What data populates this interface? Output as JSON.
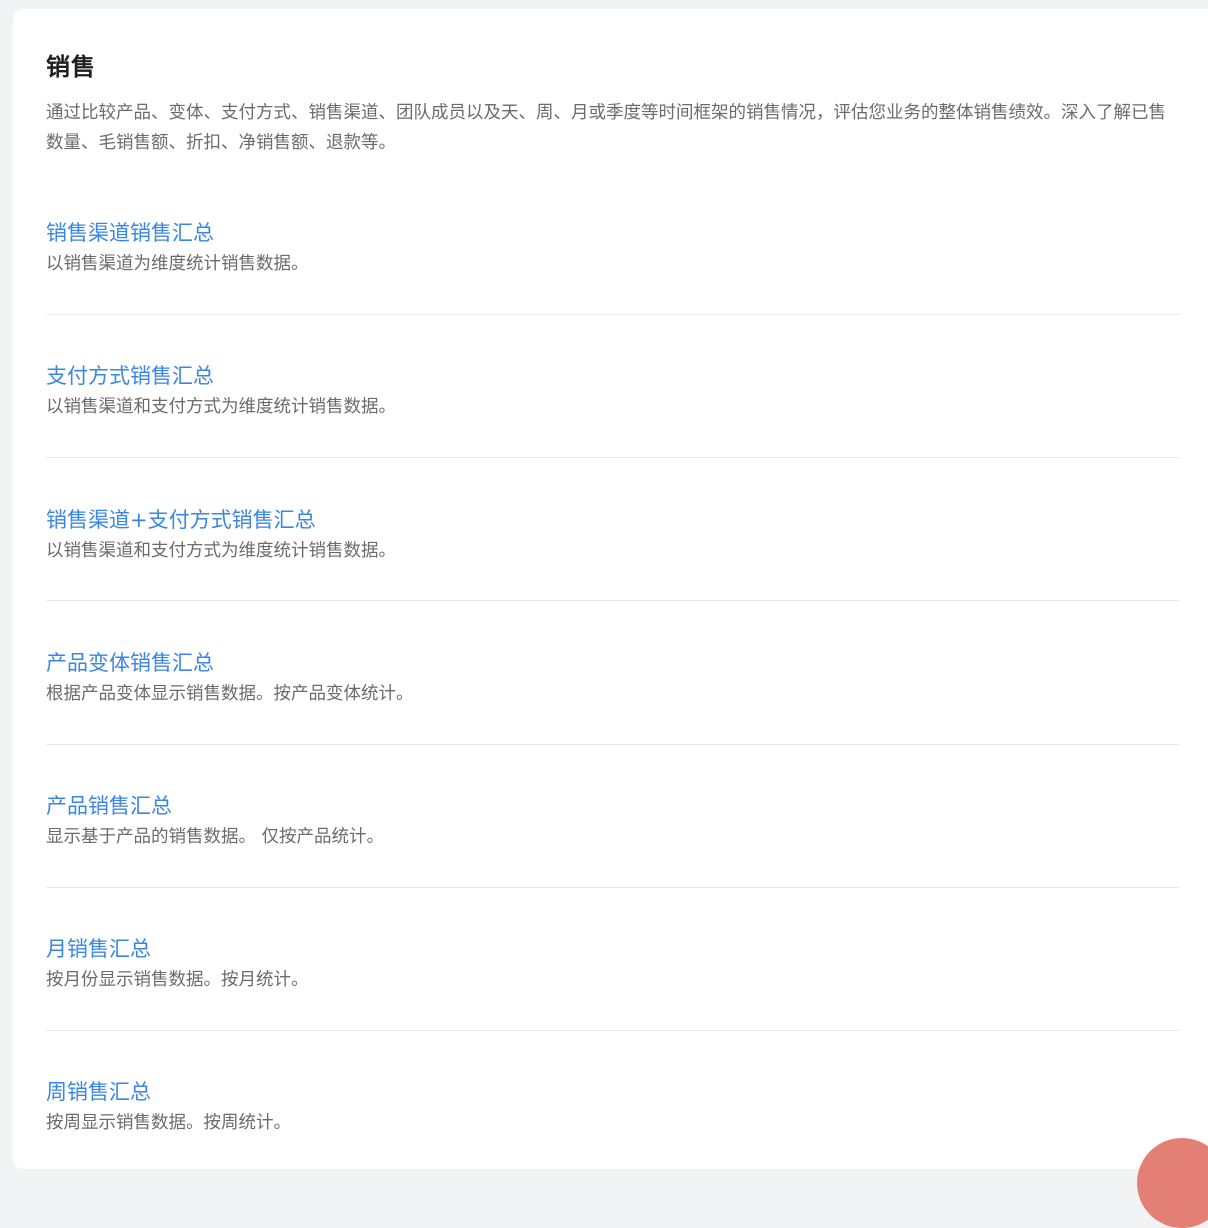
{
  "section": {
    "title": "销售",
    "intro": "通过比较产品、变体、支付方式、销售渠道、团队成员以及天、周、月或季度等时间框架的销售情况，评估您业务的整体销售绩效。深入了解已售数量、毛销售额、折扣、净销售额、退款等。"
  },
  "reports": [
    {
      "title": "销售渠道销售汇总",
      "description": "以销售渠道为维度统计销售数据。"
    },
    {
      "title": "支付方式销售汇总",
      "description": "以销售渠道和支付方式为维度统计销售数据。"
    },
    {
      "title": "销售渠道+支付方式销售汇总",
      "description": "以销售渠道和支付方式为维度统计销售数据。"
    },
    {
      "title": "产品变体销售汇总",
      "description": "根据产品变体显示销售数据。按产品变体统计。"
    },
    {
      "title": "产品销售汇总",
      "description": "显示基于产品的销售数据。 仅按产品统计。"
    },
    {
      "title": "月销售汇总",
      "description": "按月份显示销售数据。按月统计。"
    },
    {
      "title": "周销售汇总",
      "description": "按周显示销售数据。按周统计。"
    }
  ],
  "colors": {
    "link": "#3a86e6",
    "floating_button": "#e37f74"
  }
}
